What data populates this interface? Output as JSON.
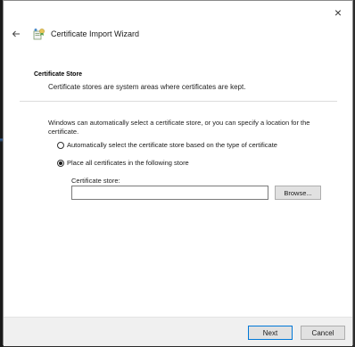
{
  "window": {
    "title": "Certificate Import Wizard",
    "close_symbol": "×",
    "back_symbol": "←",
    "icons": {
      "close": "close-icon",
      "back": "back-arrow-icon",
      "wizard": "certificate-wizard-icon"
    }
  },
  "section": {
    "title": "Certificate Store",
    "description": "Certificate stores are system areas where certificates are kept."
  },
  "body": {
    "intro": "Windows can automatically select a certificate store, or you can specify a location for the certificate.",
    "options": [
      {
        "label": "Automatically select the certificate store based on the type of certificate",
        "selected": false
      },
      {
        "label": "Place all certificates in the following store",
        "selected": true
      }
    ],
    "store_label": "Certificate store:",
    "store_value": "",
    "browse_label": "Browse..."
  },
  "footer": {
    "next_label": "Next",
    "cancel_label": "Cancel"
  },
  "colors": {
    "accent": "#0078d7",
    "footer_bg": "#f0f0f0",
    "button_bg": "#e1e1e1"
  }
}
